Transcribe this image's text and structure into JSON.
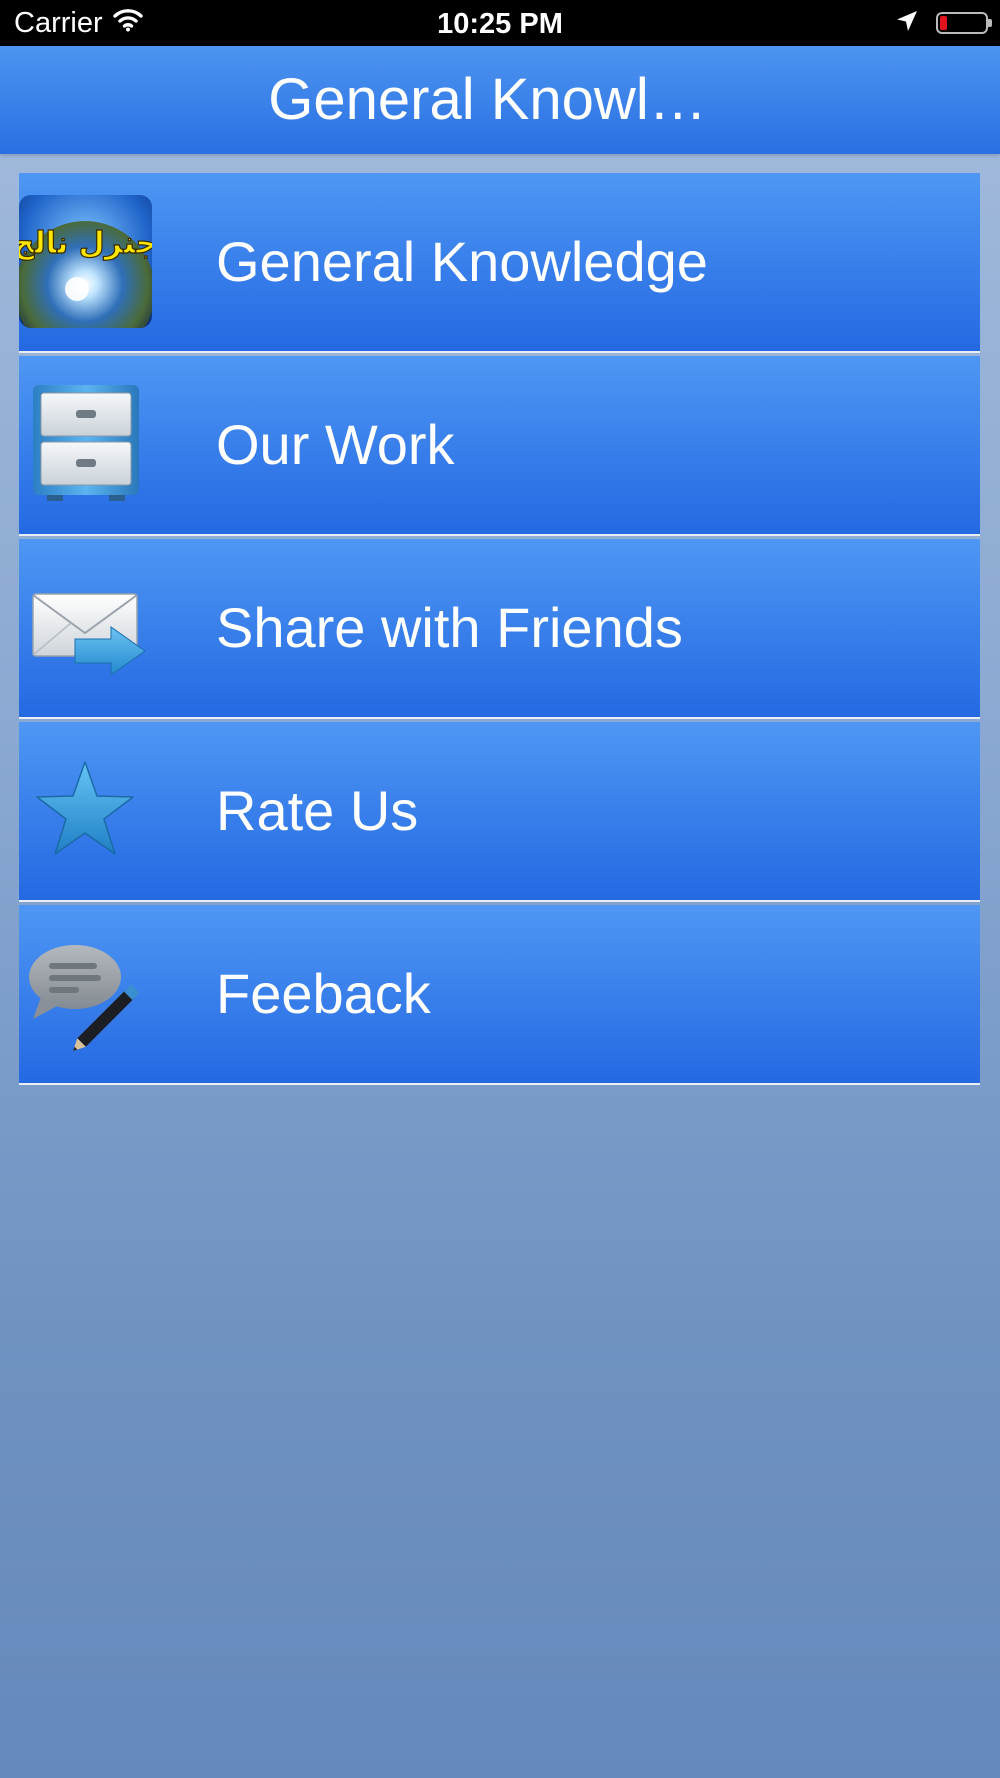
{
  "status_bar": {
    "carrier": "Carrier",
    "time": "10:25 PM",
    "battery_level": 0.15,
    "battery_color": "#e0141a",
    "icons": [
      "wifi-icon",
      "location-arrow-icon",
      "battery-icon"
    ]
  },
  "nav": {
    "title": "General Knowl…"
  },
  "menu": {
    "items": [
      {
        "label": "General Knowledge",
        "icon": "app-logo-icon",
        "logo_text": "جنرل نالج"
      },
      {
        "label": "Our Work",
        "icon": "file-cabinet-icon"
      },
      {
        "label": "Share with Friends",
        "icon": "envelope-share-icon"
      },
      {
        "label": "Rate Us",
        "icon": "star-icon"
      },
      {
        "label": "Feeback",
        "icon": "speech-bubble-pencil-icon"
      }
    ]
  },
  "colors": {
    "nav_top": "#4d95f0",
    "nav_bottom": "#2a6fe3",
    "row_top": "#4f97f3",
    "row_bottom": "#2569e2",
    "background_top": "#a4bcdd",
    "background_bottom": "#6589bb"
  }
}
